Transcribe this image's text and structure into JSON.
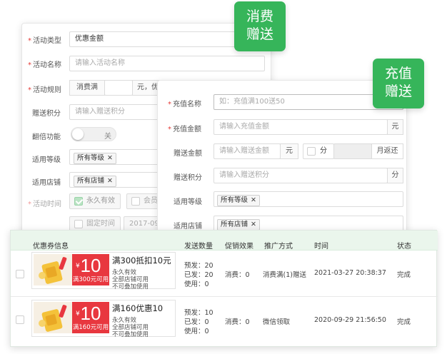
{
  "badges": {
    "consume": {
      "line1": "消费",
      "line2": "赠送",
      "color": "#36b55a"
    },
    "recharge": {
      "line1": "充值",
      "line2": "赠送",
      "color": "#36b55a"
    }
  },
  "back_form": {
    "type_label": "活动类型",
    "type_value": "优惠金额",
    "name_label": "活动名称",
    "name_placeholder": "请输入活动名称",
    "rule_label": "活动规则",
    "rule_prefix": "消费满",
    "rule_unit": "元，",
    "rule_more": "优",
    "points_label": "赠送积分",
    "points_placeholder": "请输入赠送积分",
    "double_label": "翻倍功能",
    "double_toggle": "关",
    "level_label": "适用等级",
    "level_tag": "所有等级",
    "store_label": "适用店铺",
    "store_tag": "所有店铺",
    "time_label": "活动时间",
    "time_permanent": "永久有效",
    "time_member": "会员",
    "time_fixed": "固定时间",
    "time_date": "2017-09"
  },
  "front_form": {
    "name_label": "充值名称",
    "name_placeholder": "如：充值满100送50",
    "amount_label": "充值金额",
    "amount_placeholder": "请输入充值金额",
    "amount_unit": "元",
    "gift_label": "赠送金额",
    "gift_placeholder": "请输入赠送金额",
    "gift_unit": "元",
    "gift_split": "分",
    "gift_return": "月返还",
    "points_label": "赠送积分",
    "points_placeholder": "请输入赠送积分",
    "points_unit": "分",
    "level_label": "适用等级",
    "level_tag": "所有等级",
    "store_label": "适用店铺",
    "store_tag": "所有店铺"
  },
  "table": {
    "headers": {
      "coupon": "优惠券信息",
      "quantity": "发送数量",
      "effect": "促销效果",
      "method": "推广方式",
      "time": "时间",
      "status": "状态"
    },
    "rows": [
      {
        "amount": "10",
        "yen": "¥",
        "amount_sub": "满300元可用",
        "title": "满300抵扣10元",
        "line1": "永久有效",
        "line2": "全部店铺可用",
        "line3": "不可叠加使用",
        "q1": "预发：20",
        "q2": "已发：20",
        "q3": "使用：0",
        "effect": "消费：0",
        "method": "消费满(1)赠送",
        "time": "2021-03-27 20:38:37",
        "status": "完成"
      },
      {
        "amount": "10",
        "yen": "¥",
        "amount_sub": "满160元可用",
        "title": "满160优惠10",
        "line1": "永久有效",
        "line2": "全部店铺可用",
        "line3": "不可叠加使用",
        "q1": "预发：10",
        "q2": "已发：0",
        "q3": "使用：0",
        "effect": "消费：0",
        "method": "微信领取",
        "time": "2020-09-29 21:56:50",
        "status": "完成"
      }
    ]
  },
  "close_icon_glyph": "✕",
  "colors": {
    "green": "#36b55a",
    "red": "#e8373f",
    "table_header": "#eaf6ec"
  }
}
